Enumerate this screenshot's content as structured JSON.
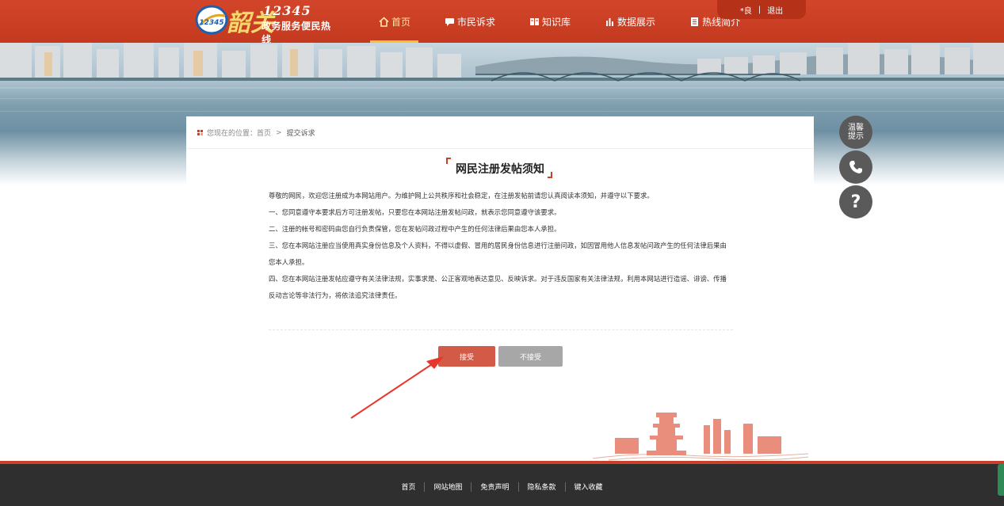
{
  "header": {
    "logo": {
      "number": "12345",
      "subtitle": "政务服务便民热线",
      "script": "韶关",
      "badge_text": "12345"
    },
    "nav": [
      {
        "label": "首页",
        "icon": "home-icon",
        "active": true
      },
      {
        "label": "市民诉求",
        "icon": "chat-icon",
        "active": false
      },
      {
        "label": "知识库",
        "icon": "book-icon",
        "active": false
      },
      {
        "label": "数据展示",
        "icon": "bar-chart-icon",
        "active": false
      },
      {
        "label": "热线简介",
        "icon": "document-icon",
        "active": false
      }
    ],
    "user": {
      "name": "*良",
      "sep": "|",
      "logout": "退出"
    }
  },
  "breadcrumb": {
    "prefix": "您现在的位置：",
    "home": "首页",
    "sep": ">",
    "current": "提交诉求"
  },
  "notice": {
    "title": "网民注册发帖须知",
    "paragraphs": [
      "尊敬的网民，欢迎您注册成为本网站用户。为维护网上公共秩序和社会稳定，在注册发帖前请您认真阅读本须知，并遵守以下要求。",
      "一、您同意遵守本要求后方可注册发帖，只要您在本网站注册发帖问政，就表示您同意遵守该要求。",
      "二、注册的帐号和密码由您自行负责保管，您在发帖问政过程中产生的任何法律后果由您本人承担。",
      "三、您在本网站注册应当使用真实身份信息及个人资料，不得以虚假、冒用的居民身份信息进行注册问政，如因冒用他人信息发帖问政产生的任何法律后果由您本人承担。",
      "四、您在本网站注册发帖应遵守有关法律法规，实事求是、公正客观地表达意见、反映诉求。对于违反国家有关法律法规，利用本网站进行造谣、诽谤、传播反动言论等非法行为，将依法追究法律责任。"
    ]
  },
  "buttons": {
    "accept": "接受",
    "decline": "不接受"
  },
  "side_tools": {
    "tip_line1": "温馨",
    "tip_line2": "提示",
    "help": "?"
  },
  "footer": {
    "links": [
      "首页",
      "网站地图",
      "免责声明",
      "隐私条款",
      "键入收藏"
    ]
  },
  "colors": {
    "brand_red": "#c9402a",
    "accent_gold": "#f4c43a",
    "accept": "#d25a46",
    "decline": "#a7a7a7",
    "footer": "#2f2f2f"
  }
}
